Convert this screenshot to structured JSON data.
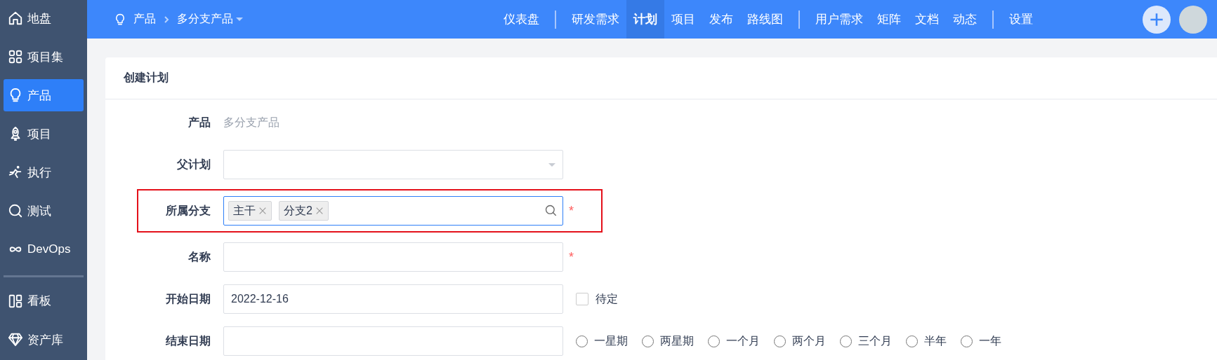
{
  "sidebar": {
    "items": [
      {
        "label": "地盘",
        "selected": false
      },
      {
        "label": "项目集",
        "selected": false
      },
      {
        "label": "产品",
        "selected": true
      },
      {
        "label": "项目",
        "selected": false
      },
      {
        "label": "执行",
        "selected": false
      },
      {
        "label": "测试",
        "selected": false
      },
      {
        "label": "DevOps",
        "selected": false
      },
      {
        "label": "看板",
        "selected": false,
        "divider_before": true
      },
      {
        "label": "资产库",
        "selected": false
      }
    ]
  },
  "topbar": {
    "breadcrumb": {
      "root": "产品",
      "current": "多分支产品"
    },
    "nav_groups": [
      [
        {
          "label": "仪表盘",
          "selected": false
        }
      ],
      [
        {
          "label": "研发需求",
          "selected": false
        },
        {
          "label": "计划",
          "selected": true
        },
        {
          "label": "项目",
          "selected": false
        },
        {
          "label": "发布",
          "selected": false
        },
        {
          "label": "路线图",
          "selected": false
        }
      ],
      [
        {
          "label": "用户需求",
          "selected": false
        },
        {
          "label": "矩阵",
          "selected": false
        },
        {
          "label": "文档",
          "selected": false
        },
        {
          "label": "动态",
          "selected": false
        }
      ],
      [
        {
          "label": "设置",
          "selected": false
        }
      ]
    ]
  },
  "card": {
    "title": "创建计划",
    "rows": [
      {
        "kind": "text",
        "label": "产品",
        "value": "多分支产品"
      },
      {
        "kind": "select",
        "label": "父计划"
      },
      {
        "kind": "tags",
        "label": "所属分支",
        "required": "*",
        "highlighted": true,
        "tags": [
          "主干",
          "分支2"
        ]
      },
      {
        "kind": "input",
        "label": "名称",
        "required": "*"
      },
      {
        "kind": "input",
        "label": "开始日期",
        "value": "2022-12-16",
        "checkbox": {
          "label": "待定",
          "checked": false
        }
      },
      {
        "kind": "input",
        "label": "结束日期",
        "radios": [
          {
            "label": "一星期",
            "selected": false
          },
          {
            "label": "两星期",
            "selected": false
          },
          {
            "label": "一个月",
            "selected": false
          },
          {
            "label": "两个月",
            "selected": false
          },
          {
            "label": "三个月",
            "selected": false
          },
          {
            "label": "半年",
            "selected": false
          },
          {
            "label": "一年",
            "selected": false
          }
        ]
      }
    ]
  }
}
